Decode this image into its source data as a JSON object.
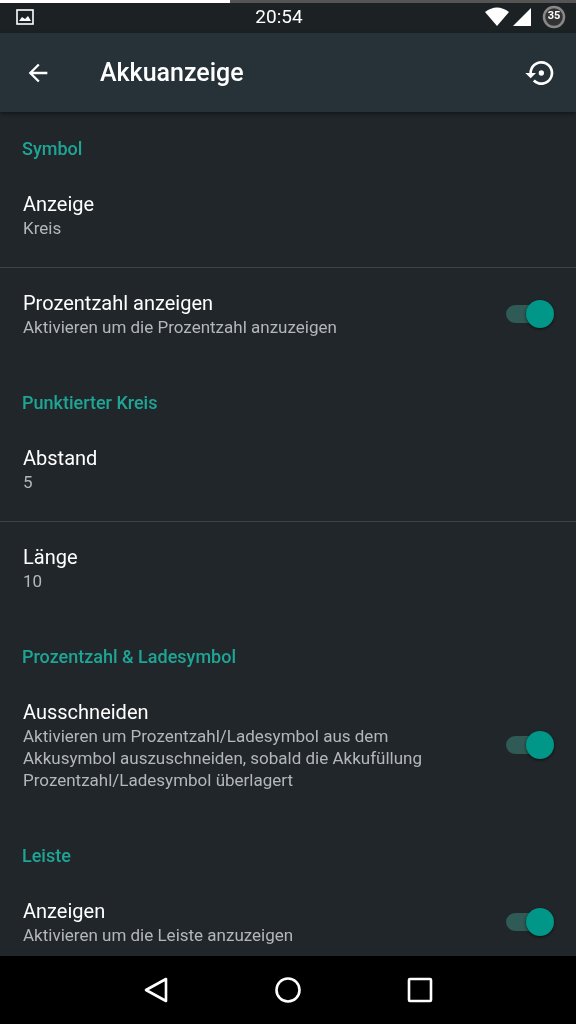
{
  "status_bar": {
    "time": "20:54",
    "battery": "35",
    "progress": {
      "level": 0.4
    }
  },
  "app_bar": {
    "title": "Akkuanzeige"
  },
  "list": [
    {
      "kind": "header",
      "title": "Symbol"
    },
    {
      "kind": "item",
      "title": "Anzeige",
      "summary": "Kreis",
      "divider": true
    },
    {
      "kind": "item",
      "title": "Prozentzahl anzeigen",
      "summary": "Aktivieren um die Prozentzahl anzuzeigen",
      "divider": false,
      "switch": {
        "on": true
      }
    },
    {
      "kind": "header",
      "title": "Punktierter Kreis"
    },
    {
      "kind": "item",
      "title": "Abstand",
      "summary": "5",
      "divider": true
    },
    {
      "kind": "item",
      "title": "Länge",
      "summary": "10",
      "divider": false
    },
    {
      "kind": "header",
      "title": "Prozentzahl & Ladesymbol"
    },
    {
      "kind": "item",
      "title": "Ausschneiden",
      "summary": "Aktivieren um Prozentzahl/Ladesymbol aus dem Akkusymbol auszuschneiden, sobald die Akkufüllung Prozentzahl/Ladesymbol überlagert",
      "divider": false,
      "switch": {
        "on": true
      }
    },
    {
      "kind": "header",
      "title": "Leiste"
    },
    {
      "kind": "item",
      "title": "Anzeigen",
      "summary": "Aktivieren um die Leiste anzuzeigen",
      "divider": false,
      "switch": {
        "on": true
      }
    }
  ]
}
